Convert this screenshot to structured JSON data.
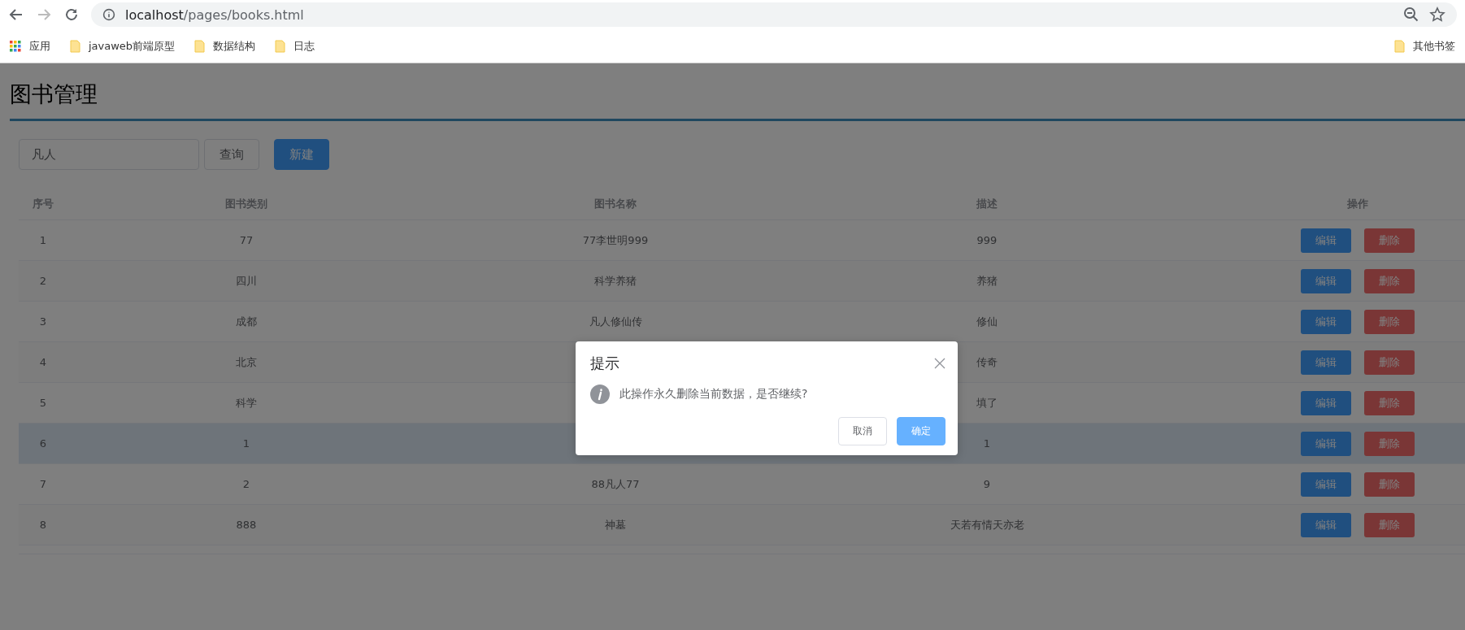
{
  "browser": {
    "url_host": "localhost",
    "url_path": "/pages/books.html",
    "bookmarks": [
      {
        "kind": "apps",
        "label": "应用"
      },
      {
        "kind": "folder",
        "label": "javaweb前端原型"
      },
      {
        "kind": "folder",
        "label": "数据结构"
      },
      {
        "kind": "folder",
        "label": "日志"
      }
    ],
    "other_bookmarks": "其他书签"
  },
  "page": {
    "title": "图书管理"
  },
  "toolbar": {
    "search": {
      "value": "凡人"
    },
    "query_button": "查询",
    "new_button": "新建"
  },
  "table": {
    "columns": [
      "序号",
      "图书类别",
      "图书名称",
      "描述",
      "操作"
    ],
    "rows": [
      {
        "index": "1",
        "category": "77",
        "name": "77李世明999",
        "description": "999",
        "edit": "编辑",
        "delete": "删除",
        "highlighted": false
      },
      {
        "index": "2",
        "category": "四川",
        "name": "科学养猪",
        "description": "养猪",
        "edit": "编辑",
        "delete": "删除",
        "highlighted": false
      },
      {
        "index": "3",
        "category": "成都",
        "name": "凡人修仙传",
        "description": "修仙",
        "edit": "编辑",
        "delete": "删除",
        "highlighted": false
      },
      {
        "index": "4",
        "category": "北京",
        "description": "传奇",
        "edit": "编辑",
        "delete": "删除",
        "highlighted": false
      },
      {
        "index": "5",
        "category": "科学",
        "description": "填了",
        "edit": "编辑",
        "delete": "删除",
        "highlighted": false
      },
      {
        "index": "6",
        "category": "1",
        "description": "1",
        "edit": "编辑",
        "delete": "删除",
        "highlighted": true
      },
      {
        "index": "7",
        "category": "2",
        "name": "88凡人77",
        "description": "9",
        "edit": "编辑",
        "delete": "删除",
        "highlighted": false
      },
      {
        "index": "8",
        "category": "888",
        "name": "神墓",
        "description": "天若有情天亦老",
        "edit": "编辑",
        "delete": "删除",
        "highlighted": false
      }
    ]
  },
  "dialog": {
    "title": "提示",
    "message": "此操作永久删除当前数据，是否继续?",
    "cancel": "取消",
    "confirm": "确定"
  }
}
